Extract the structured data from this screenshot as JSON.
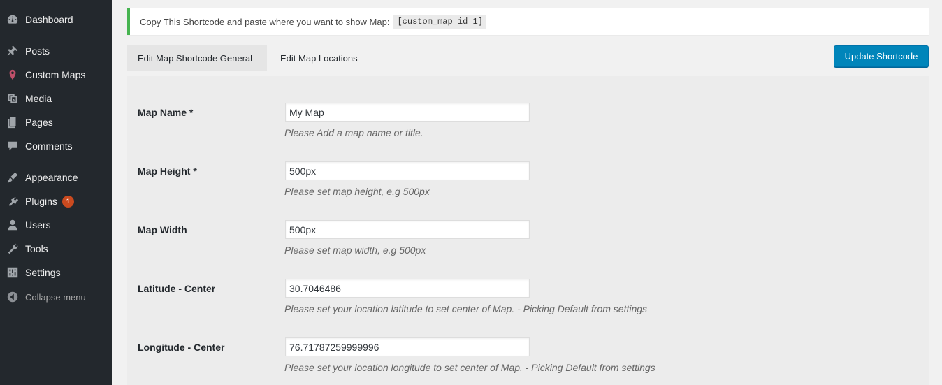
{
  "sidebar": {
    "items": [
      {
        "label": "Dashboard",
        "icon": "dashboard-icon"
      },
      {
        "label": "Posts",
        "icon": "pin-icon"
      },
      {
        "label": "Custom Maps",
        "icon": "map-marker-icon"
      },
      {
        "label": "Media",
        "icon": "media-icon"
      },
      {
        "label": "Pages",
        "icon": "pages-icon"
      },
      {
        "label": "Comments",
        "icon": "comment-icon"
      },
      {
        "label": "Appearance",
        "icon": "brush-icon"
      },
      {
        "label": "Plugins",
        "icon": "plugin-icon",
        "badge": "1"
      },
      {
        "label": "Users",
        "icon": "user-icon"
      },
      {
        "label": "Tools",
        "icon": "wrench-icon"
      },
      {
        "label": "Settings",
        "icon": "settings-icon"
      }
    ],
    "collapse_label": "Collapse menu"
  },
  "notice": {
    "text": "Copy This Shortcode and paste where you want to show Map:",
    "shortcode": "[custom_map id=1]"
  },
  "tabs": [
    {
      "label": "Edit Map Shortcode General",
      "active": true
    },
    {
      "label": "Edit Map Locations",
      "active": false
    }
  ],
  "update_button": "Update Shortcode",
  "form": {
    "fields": [
      {
        "label": "Map Name *",
        "value": "My Map",
        "description": "Please Add a map name or title."
      },
      {
        "label": "Map Height *",
        "value": "500px",
        "description": "Please set map height, e.g 500px"
      },
      {
        "label": "Map Width",
        "value": "500px",
        "description": "Please set map width, e.g 500px"
      },
      {
        "label": "Latitude - Center",
        "value": "30.7046486",
        "description": "Please set your location latitude to set center of Map. - Picking Default from settings"
      },
      {
        "label": "Longitude - Center",
        "value": "76.71787259999996",
        "description": "Please set your location longitude to set center of Map. - Picking Default from settings"
      }
    ]
  },
  "colors": {
    "sidebar_bg": "#23282d",
    "primary_button": "#0085ba",
    "notice_border": "#46b450",
    "badge": "#ca4a1f"
  }
}
